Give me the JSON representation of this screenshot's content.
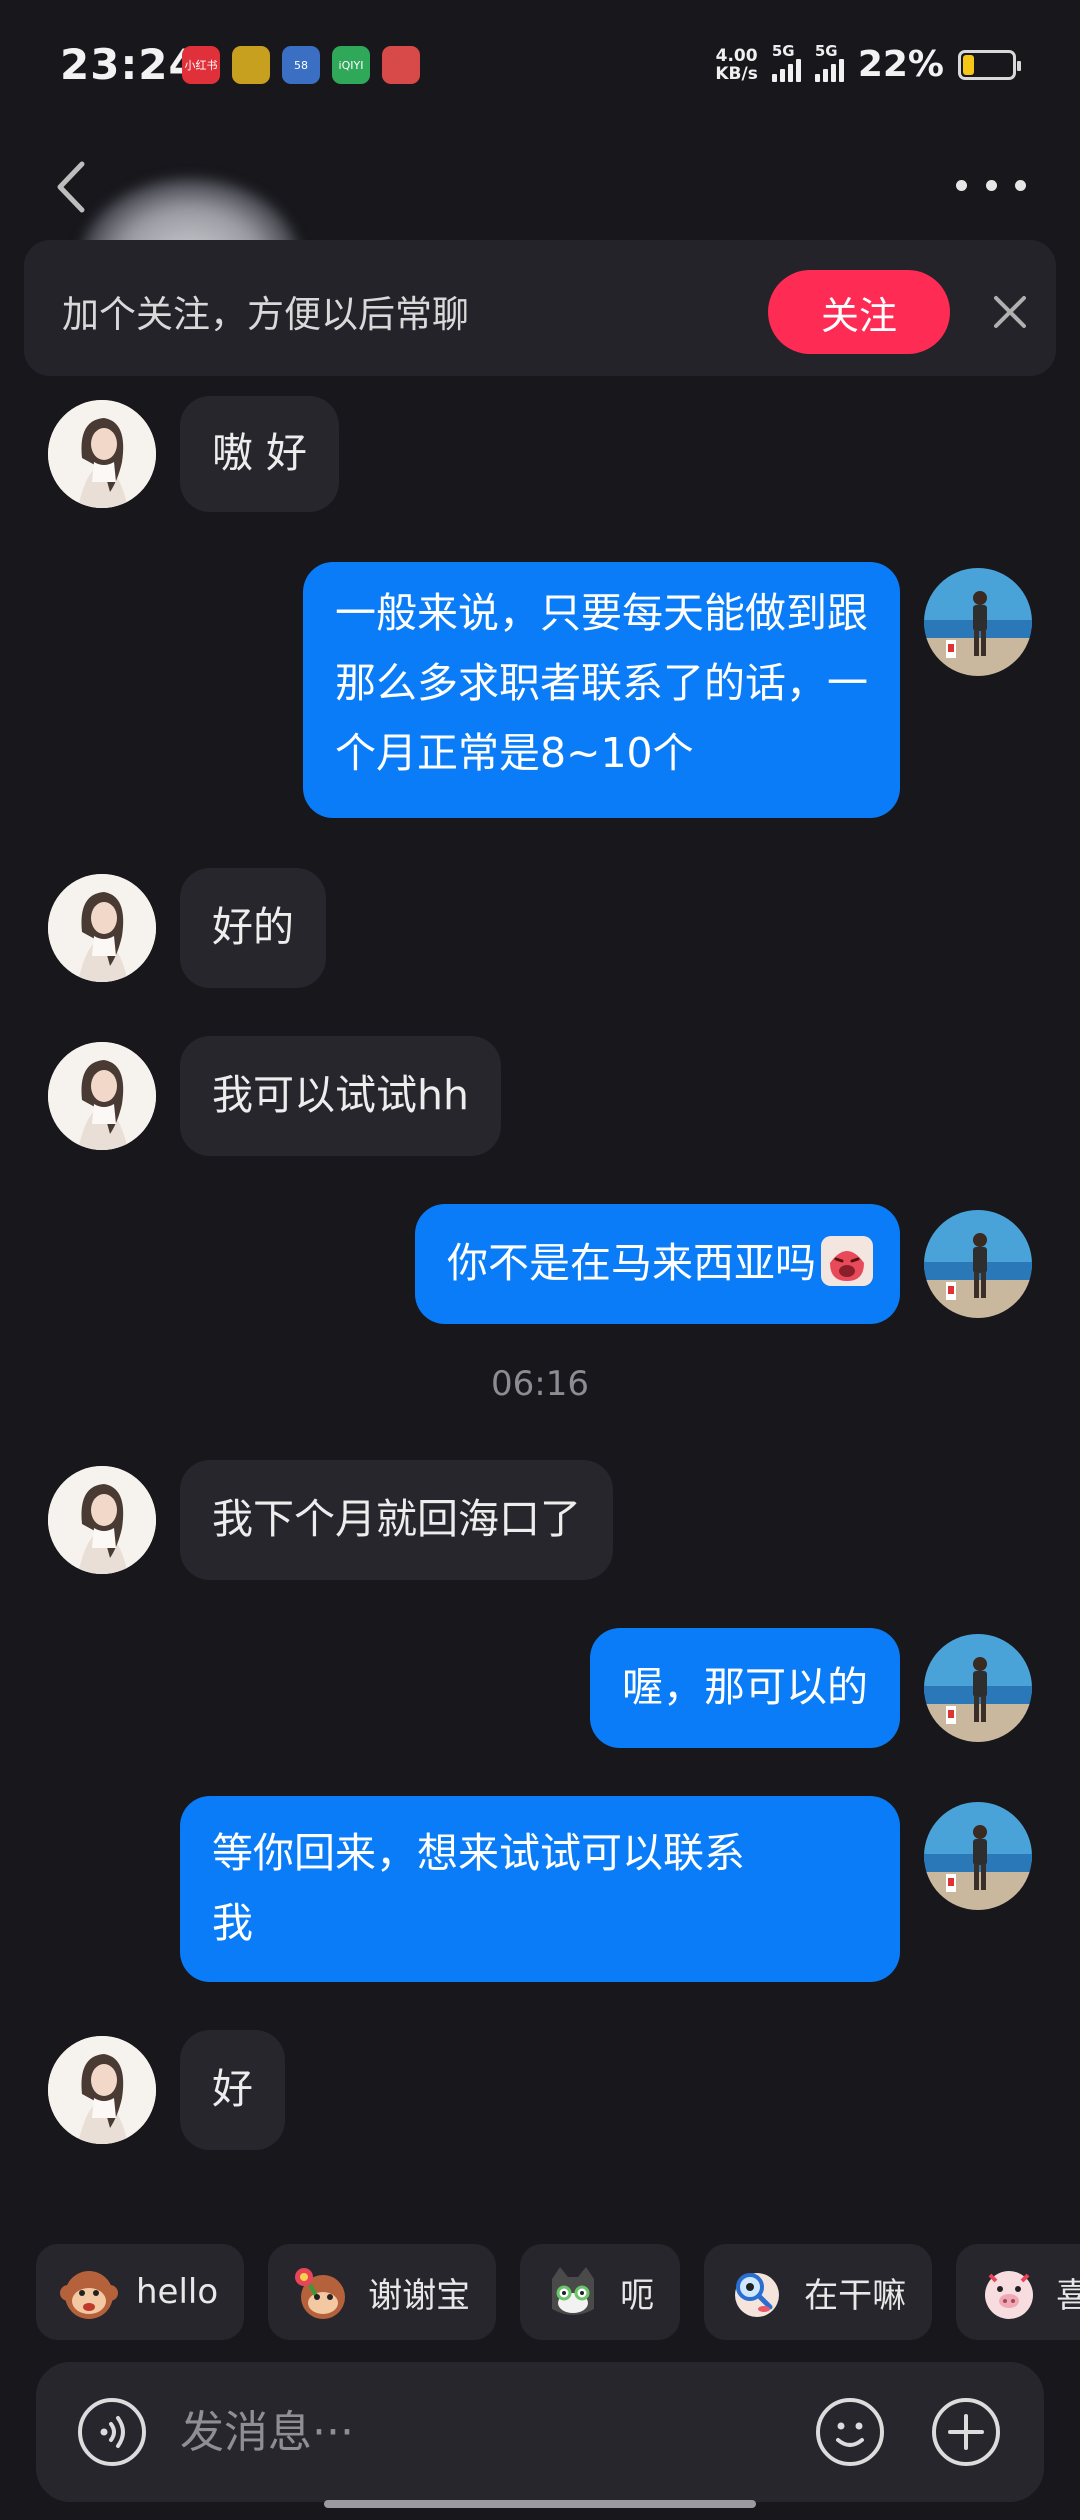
{
  "status_bar": {
    "time": "23:24",
    "net_speed_value": "4.00",
    "net_speed_unit": "KB/s",
    "sim1": "5G",
    "sim2": "5G",
    "battery_text": "22%",
    "battery_level": 0.22,
    "app_icons": [
      "小红书",
      "app-icon",
      "58",
      "iQIYI",
      "app-icon"
    ]
  },
  "header": {
    "contact_name": ""
  },
  "follow_banner": {
    "text": "加个关注，方便以后常聊",
    "button_label": "关注"
  },
  "messages": [
    {
      "from": "her",
      "lines": [
        "嗷 好"
      ]
    },
    {
      "from": "me",
      "lines": [
        "一般来说，只要每天能做到跟",
        "那么多求职者联系了的话，一",
        "个月正常是8~10个"
      ]
    },
    {
      "from": "her",
      "lines": [
        "好的"
      ]
    },
    {
      "from": "her",
      "lines": [
        "我可以试试hh"
      ]
    },
    {
      "from": "me",
      "lines": [
        "你不是在马来西亚吗"
      ],
      "emoji": "crying-face-sticker"
    },
    {
      "from": "her",
      "lines": [
        "我下个月就回海口了"
      ]
    },
    {
      "from": "me",
      "lines": [
        "喔，那可以的"
      ]
    },
    {
      "from": "me",
      "lines": [
        "等你回来，想来试试可以联系",
        "我"
      ]
    },
    {
      "from": "her",
      "lines": [
        "好"
      ]
    }
  ],
  "timestamp": "06:16",
  "quick_replies": [
    {
      "label": "hello",
      "icon": "monkey-sticker"
    },
    {
      "label": "谢谢宝",
      "icon": "monkey-flower-sticker"
    },
    {
      "label": "呃",
      "icon": "cat-sticker"
    },
    {
      "label": "在干嘛",
      "icon": "magnifier-sticker"
    },
    {
      "label": "喜",
      "icon": "pig-sticker"
    }
  ],
  "input": {
    "placeholder": "发消息···"
  },
  "colors": {
    "background": "#17171c",
    "incoming_bubble": "#26262c",
    "outgoing_bubble": "#0a7cf7",
    "follow_button": "#fe2c55"
  }
}
